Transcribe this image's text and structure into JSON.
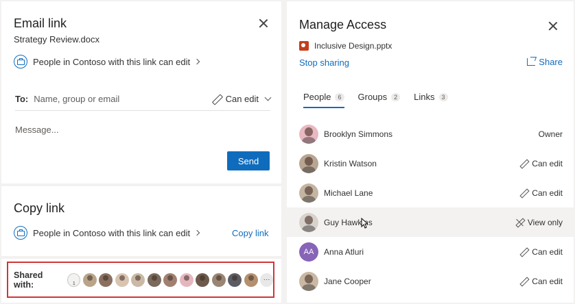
{
  "email_link": {
    "title": "Email link",
    "filename": "Strategy Review.docx",
    "link_setting": "People in Contoso with this link can edit",
    "to_label": "To:",
    "to_placeholder": "Name, group or email",
    "permission": "Can edit",
    "message_placeholder": "Message...",
    "send_label": "Send"
  },
  "copy_link": {
    "title": "Copy link",
    "link_setting": "People in Contoso with this link can edit",
    "action_label": "Copy link"
  },
  "shared_with": {
    "label": "Shared with:",
    "group_count": "1",
    "avatar_colors": [
      "#b9a48a",
      "#8a7060",
      "#d8c4b0",
      "#c9b9a6",
      "#7a6a5c",
      "#a08070",
      "#e4b7bf",
      "#6e5a4c",
      "#9a8474",
      "#5c5c64",
      "#b39070"
    ],
    "more_label": "···"
  },
  "manage_access": {
    "title": "Manage Access",
    "filename": "Inclusive Design.pptx",
    "stop_sharing": "Stop sharing",
    "share_label": "Share",
    "tabs": [
      {
        "label": "People",
        "count": "6",
        "active": true
      },
      {
        "label": "Groups",
        "count": "2",
        "active": false
      },
      {
        "label": "Links",
        "count": "3",
        "active": false
      }
    ],
    "people": [
      {
        "name": "Brooklyn Simmons",
        "permission": "Owner",
        "perm_icon": "none",
        "avatar_color": "#e9b8c1"
      },
      {
        "name": "Kristin Watson",
        "permission": "Can edit",
        "perm_icon": "pencil-icon",
        "avatar_color": "#b8a592"
      },
      {
        "name": "Michael Lane",
        "permission": "Can edit",
        "perm_icon": "pencil-icon",
        "avatar_color": "#c4b5a2"
      },
      {
        "name": "Guy Hawkins",
        "permission": "View only",
        "perm_icon": "no-edit-icon",
        "avatar_color": "#d8d2cc"
      },
      {
        "name": "Anna Atluri",
        "initials": "AA",
        "permission": "Can edit",
        "perm_icon": "pencil-icon",
        "avatar_color": "#8764b8"
      },
      {
        "name": "Jane Cooper",
        "permission": "Can edit",
        "perm_icon": "pencil-icon",
        "avatar_color": "#c9b8a4"
      }
    ]
  },
  "colors": {
    "accent": "#0f6cbd",
    "highlight_border": "#d13438",
    "panel_bg": "#f3f2f1"
  }
}
